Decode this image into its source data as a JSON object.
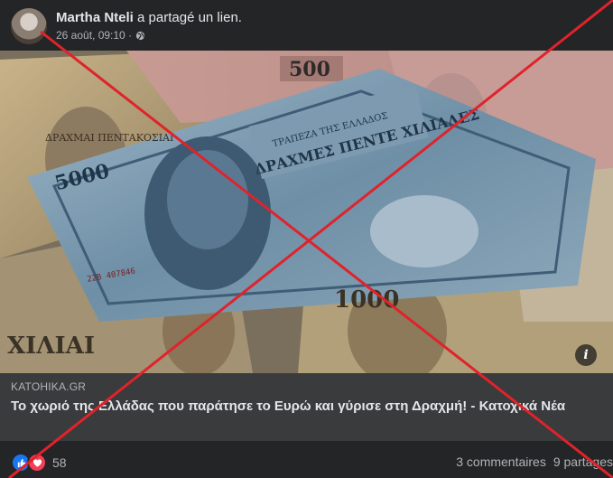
{
  "post": {
    "author": "Martha Nteli",
    "action": "a partagé un lien.",
    "timestamp": "26 août, 09:10 ·",
    "privacy_icon": "globe-icon"
  },
  "image": {
    "banknote_texts": [
      "ΔΡΑΧΜΑΙ ΠΕΝΤΑΚΟΣΙΑΙ",
      "500",
      "ΤΡΑΠΕΖΑ ΤΗΣ ΕΛΛΑΔΟΣ",
      "ΔΡΑΧΜΕΣ ΠΕΝΤΕ ΧΙΛΙΑΔΕΣ",
      "5000",
      "22Β 407846",
      "1000",
      "ΧΙΛΙΑΙ"
    ],
    "info_label": "i"
  },
  "link": {
    "domain": "KATOHIKA.GR",
    "title": "Το χωριό της Ελλάδας που παράτησε το Ευρώ και γύρισε στη Δραχμή! - Κατοχικά Νέα"
  },
  "footer": {
    "reaction_count": "58",
    "comments": "3 commentaires",
    "shares": "9 partages"
  },
  "colors": {
    "cross": "#e0232b",
    "background": "#242526",
    "link_box": "#3a3b3c"
  }
}
